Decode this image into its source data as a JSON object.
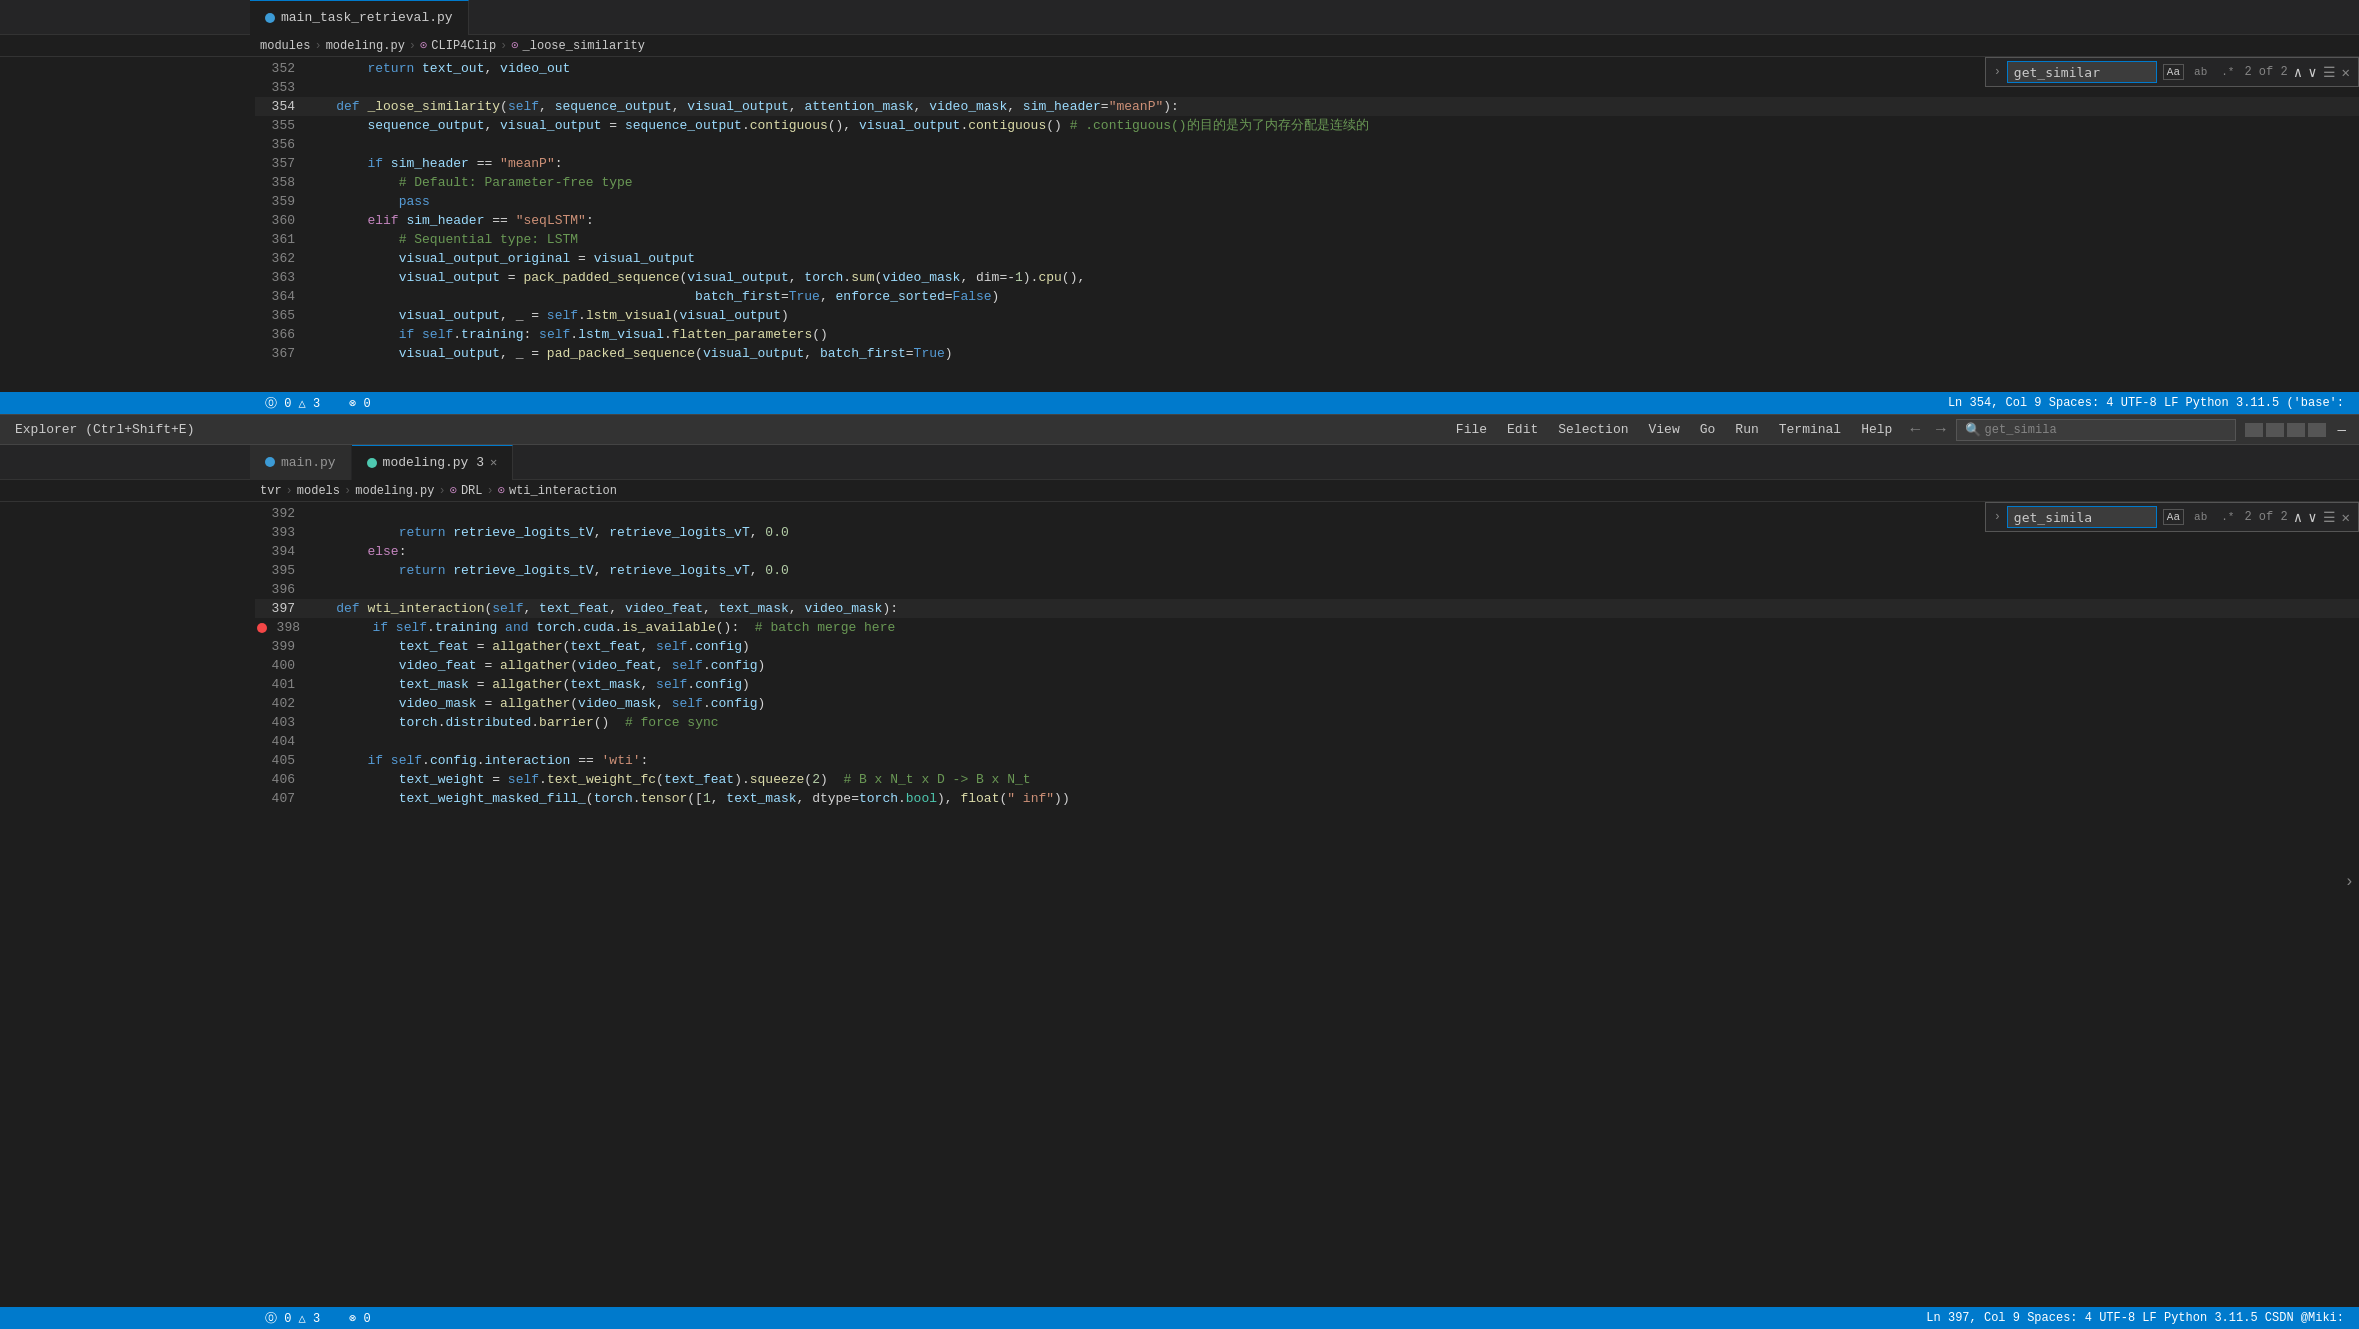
{
  "top_pane": {
    "tabs": [
      {
        "label": "main_task_retrieval.py",
        "active": true,
        "type": "py"
      }
    ],
    "breadcrumb": [
      "modules",
      "modeling.py",
      "CLIP4Clip",
      "_loose_similarity"
    ],
    "search_widget": {
      "value": "get_similar",
      "count": "2 of 2",
      "match_case": "Aa",
      "whole_word": "ab",
      "regex": ".*"
    },
    "lines": [
      {
        "num": "352",
        "content": "        return text_out, video_out",
        "indent": 0
      },
      {
        "num": "353",
        "content": "",
        "indent": 0
      },
      {
        "num": "354",
        "content": "    def _loose_similarity(self, sequence_output, visual_output, attention_mask, video_mask, sim_header=\"meanP\"):",
        "indent": 0,
        "highlight": true
      },
      {
        "num": "355",
        "content": "        sequence_output, visual_output = sequence_output.contiguous(), visual_output.contiguous() # .contiguous()的目的是为了内存分配是连续的",
        "indent": 0
      },
      {
        "num": "356",
        "content": "",
        "indent": 0
      },
      {
        "num": "357",
        "content": "        if sim_header == \"meanP\":",
        "indent": 0
      },
      {
        "num": "358",
        "content": "            # Default: Parameter-free type",
        "indent": 0
      },
      {
        "num": "359",
        "content": "            pass",
        "indent": 0
      },
      {
        "num": "360",
        "content": "        elif sim_header == \"seqLSTM\":",
        "indent": 0
      },
      {
        "num": "361",
        "content": "            # Sequential type: LSTM",
        "indent": 0
      },
      {
        "num": "362",
        "content": "            visual_output_original = visual_output",
        "indent": 0
      },
      {
        "num": "363",
        "content": "            visual_output = pack_padded_sequence(visual_output, torch.sum(video_mask, dim=-1).cpu(),",
        "indent": 0
      },
      {
        "num": "364",
        "content": "                                                  batch_first=True, enforce_sorted=False)",
        "indent": 0
      },
      {
        "num": "365",
        "content": "            visual_output, _ = self.lstm_visual(visual_output)",
        "indent": 0
      },
      {
        "num": "366",
        "content": "            if self.training: self.lstm_visual.flatten_parameters()",
        "indent": 0
      },
      {
        "num": "367",
        "content": "            visual_output, _ = pad_packed_sequence(visual_output, batch_first=True)",
        "indent": 0
      }
    ],
    "status": "Ln 354, Col 9  Spaces: 4  UTF-8  LF  Python  3.11.5 ('base':"
  },
  "bottom_pane": {
    "menu": {
      "items": [
        "File",
        "Edit",
        "Selection",
        "View",
        "Go",
        "Run",
        "Terminal",
        "Help"
      ],
      "selection_item": "Selection"
    },
    "tabs": [
      {
        "label": "main.py",
        "active": false,
        "type": "py"
      },
      {
        "label": "modeling.py 3",
        "active": true,
        "type": "py",
        "closeable": true
      }
    ],
    "breadcrumb": [
      "tvr",
      "models",
      "modeling.py",
      "DRL",
      "wti_interaction"
    ],
    "search_widget": {
      "value": "get_simila",
      "count": "2 of 2",
      "match_case": "Aa",
      "whole_word": "ab",
      "regex": ".*"
    },
    "lines": [
      {
        "num": "392",
        "content": "",
        "indent": 0
      },
      {
        "num": "393",
        "content": "            return retrieve_logits_tV, retrieve_logits_vT, 0.0",
        "indent": 0
      },
      {
        "num": "394",
        "content": "        else:",
        "indent": 0
      },
      {
        "num": "395",
        "content": "            return retrieve_logits_tV, retrieve_logits_vT, 0.0",
        "indent": 0
      },
      {
        "num": "396",
        "content": "",
        "indent": 0
      },
      {
        "num": "397",
        "content": "    def wti_interaction(self, text_feat, video_feat, text_mask, video_mask):",
        "indent": 0,
        "highlight": true
      },
      {
        "num": "398",
        "content": "        if self.training and torch.cuda.is_available():  # batch merge here",
        "indent": 0,
        "error": true
      },
      {
        "num": "399",
        "content": "            text_feat = allgather(text_feat, self.config)",
        "indent": 0
      },
      {
        "num": "400",
        "content": "            video_feat = allgather(video_feat, self.config)",
        "indent": 0
      },
      {
        "num": "401",
        "content": "            text_mask = allgather(text_mask, self.config)",
        "indent": 0
      },
      {
        "num": "402",
        "content": "            video_mask = allgather(video_mask, self.config)",
        "indent": 0
      },
      {
        "num": "403",
        "content": "            torch.distributed.barrier()  # force sync",
        "indent": 0
      },
      {
        "num": "404",
        "content": "",
        "indent": 0
      },
      {
        "num": "405",
        "content": "        if self.config.interaction == 'wti':",
        "indent": 0
      },
      {
        "num": "406",
        "content": "            text_weight = self.text_weight_fc(text_feat).squeeze(2)  # B x N_t x D -> B x N_t",
        "indent": 0
      },
      {
        "num": "407",
        "content": "            text_weight_masked_fill_(torch.tensor([1, text_mask, dtype=torch.bool), float(\" inf\"))",
        "indent": 0
      }
    ],
    "status": "Ln 397, Col 9  Spaces: 4  UTF-8  LF  Python  3.11.5  CSDN @Miki:"
  },
  "layout": {
    "nav_arrows": [
      "←",
      "→"
    ],
    "layout_buttons": [
      "⬜",
      "⬜",
      "⬜",
      "⊞"
    ],
    "minimize": "—"
  },
  "bottom_status": {
    "left": [
      "⓪ 0 △ 3",
      "⊗ 0"
    ],
    "right_top": [
      "Ln 354, Col 9",
      "Spaces: 4",
      "UTF-8",
      "LF",
      "Python",
      "3.11.5 ('base':"
    ],
    "right_bottom": [
      "Ln 397, Col 9",
      "Spaces: 4",
      "UTF-8",
      "LF",
      "Python",
      "3.11.5",
      "CSDN @Miki:"
    ]
  },
  "explorer": {
    "title": "Explorer (Ctrl+Shift+E)"
  }
}
